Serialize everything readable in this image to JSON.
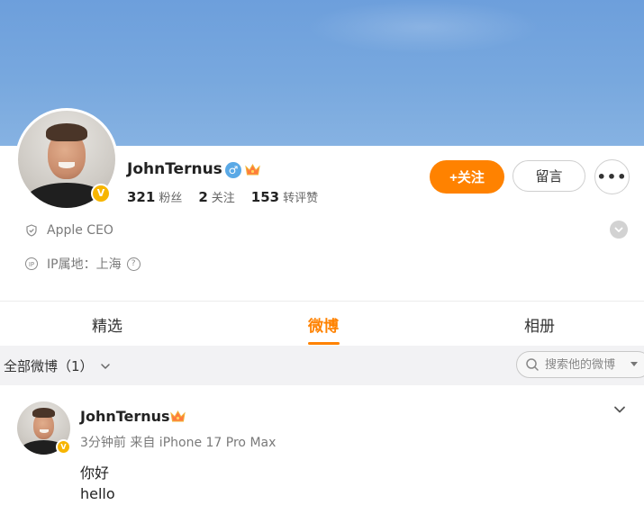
{
  "profile": {
    "name": "JohnTernus",
    "gender_icon": "male-icon",
    "badge_icon": "crown-icon",
    "verified_icon": "verified-v-icon",
    "verified_mark": "V",
    "stats": [
      {
        "value": "321",
        "label": "粉丝"
      },
      {
        "value": "2",
        "label": "关注"
      },
      {
        "value": "153",
        "label": "转评赞"
      }
    ],
    "bio": "Apple CEO",
    "ip_label": "IP属地：上海",
    "ip_badge": "IP",
    "help_mark": "?"
  },
  "actions": {
    "follow_label": "+关注",
    "message_label": "留言",
    "more_label": "•••"
  },
  "tabs": [
    {
      "label": "精选",
      "active": false
    },
    {
      "label": "微博",
      "active": true
    },
    {
      "label": "相册",
      "active": false
    }
  ],
  "filter": {
    "label": "全部微博（1）",
    "search_placeholder": "搜索他的微博"
  },
  "post": {
    "author": "JohnTernus",
    "meta": "3分钟前 来自 iPhone 17 Pro Max",
    "lines": [
      "你好",
      "hello"
    ]
  },
  "colors": {
    "accent": "#ff8200",
    "banner": "#78a8de",
    "verified": "#f7b500",
    "male": "#5aa9e6"
  }
}
